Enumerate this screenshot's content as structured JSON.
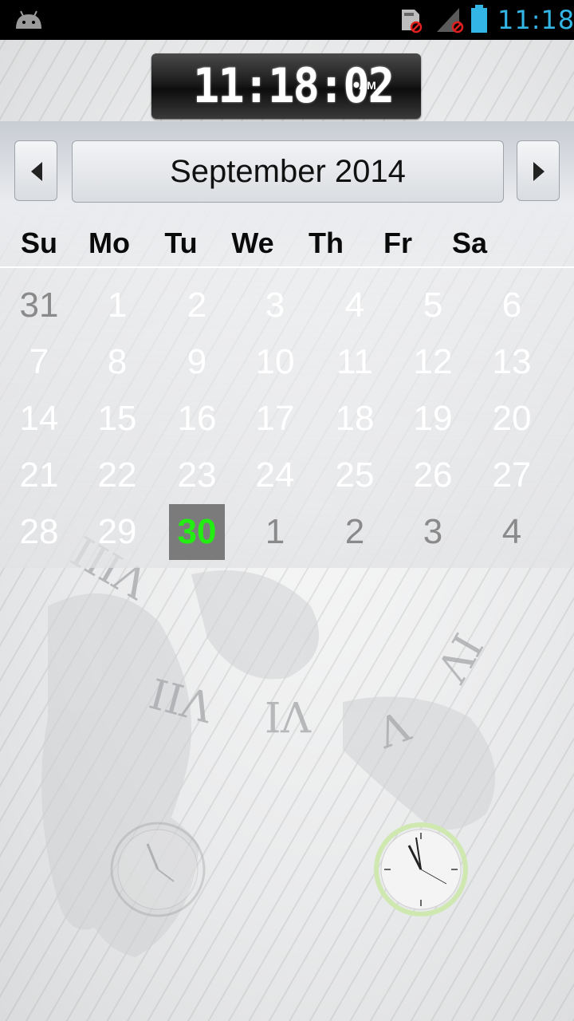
{
  "status_bar": {
    "time": "11:18",
    "icons": [
      "android-icon",
      "sd-card-blocked-icon",
      "signal-blocked-icon",
      "battery-icon"
    ],
    "time_color": "#33b5e5"
  },
  "clock": {
    "digits": "11:18:02",
    "ampm": "AM"
  },
  "calendar": {
    "month_label": "September 2014",
    "prev_icon": "chevron-left-icon",
    "next_icon": "chevron-right-icon",
    "weekdays": [
      "Su",
      "Mo",
      "Tu",
      "We",
      "Th",
      "Fr",
      "Sa"
    ],
    "weeks": [
      [
        {
          "d": "31",
          "other": true
        },
        {
          "d": "1"
        },
        {
          "d": "2"
        },
        {
          "d": "3"
        },
        {
          "d": "4"
        },
        {
          "d": "5"
        },
        {
          "d": "6"
        }
      ],
      [
        {
          "d": "7"
        },
        {
          "d": "8"
        },
        {
          "d": "9"
        },
        {
          "d": "10"
        },
        {
          "d": "11"
        },
        {
          "d": "12"
        },
        {
          "d": "13"
        }
      ],
      [
        {
          "d": "14"
        },
        {
          "d": "15"
        },
        {
          "d": "16"
        },
        {
          "d": "17"
        },
        {
          "d": "18"
        },
        {
          "d": "19"
        },
        {
          "d": "20"
        }
      ],
      [
        {
          "d": "21"
        },
        {
          "d": "22"
        },
        {
          "d": "23"
        },
        {
          "d": "24"
        },
        {
          "d": "25"
        },
        {
          "d": "26"
        },
        {
          "d": "27"
        }
      ],
      [
        {
          "d": "28"
        },
        {
          "d": "29"
        },
        {
          "d": "30",
          "today": true
        },
        {
          "d": "1",
          "other": true
        },
        {
          "d": "2",
          "other": true
        },
        {
          "d": "3",
          "other": true
        },
        {
          "d": "4",
          "other": true
        }
      ]
    ],
    "today_color": "#22ee11"
  },
  "wallpaper": {
    "roman_numerals": [
      "VIII",
      "VII",
      "VI",
      "V",
      "IV"
    ]
  }
}
